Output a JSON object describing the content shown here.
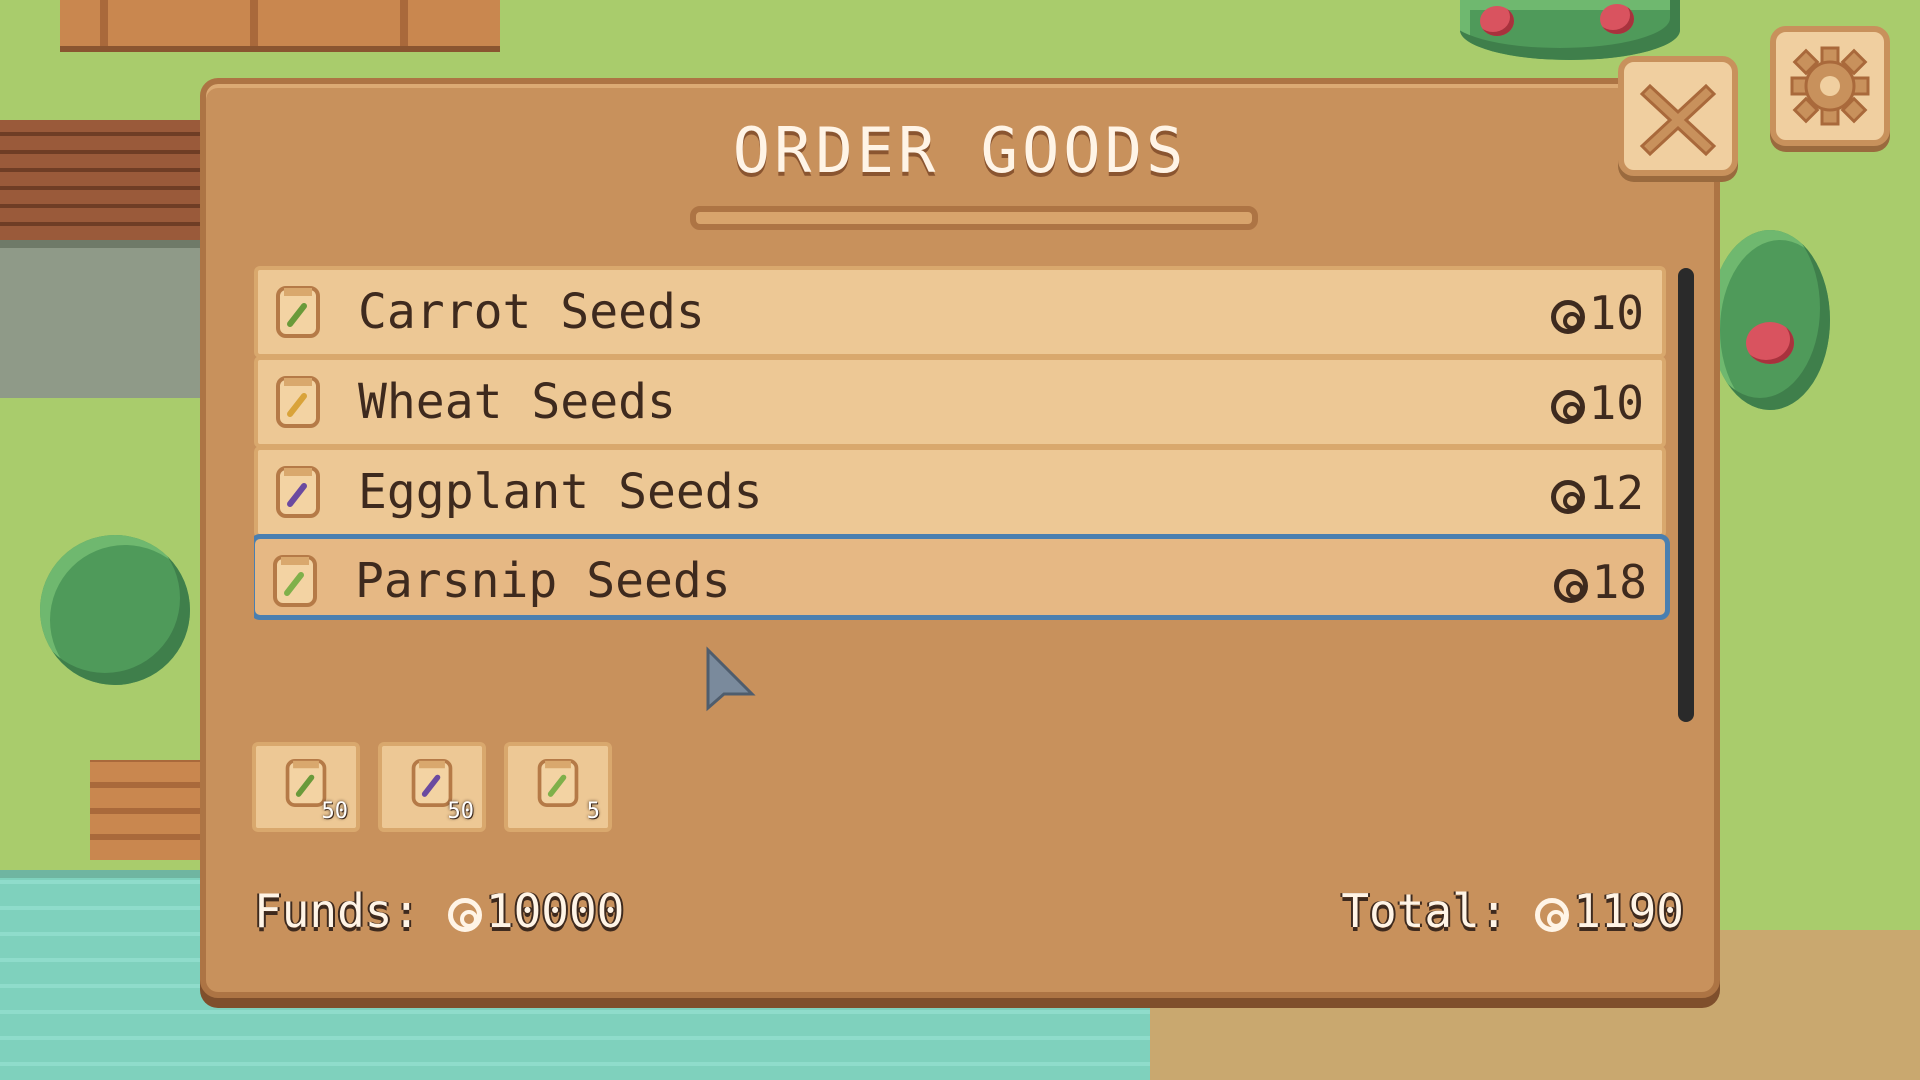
{
  "dialog": {
    "title": "ORDER GOODS",
    "items": [
      {
        "name": "Carrot Seeds",
        "price": "10",
        "icon": "carrot-seed-bag-icon",
        "accent": "#6a9a3a"
      },
      {
        "name": "Wheat Seeds",
        "price": "10",
        "icon": "wheat-seed-bag-icon",
        "accent": "#d9a33a"
      },
      {
        "name": "Eggplant Seeds",
        "price": "12",
        "icon": "eggplant-seed-bag-icon",
        "accent": "#6b4aa0"
      },
      {
        "name": "Parsnip Seeds",
        "price": "18",
        "icon": "parsnip-seed-bag-icon",
        "accent": "#7fb04a"
      }
    ],
    "selected_index": 3,
    "cart": [
      {
        "icon": "carrot-seed-bag-icon",
        "qty": "50",
        "accent": "#6a9a3a"
      },
      {
        "icon": "eggplant-seed-bag-icon",
        "qty": "50",
        "accent": "#6b4aa0"
      },
      {
        "icon": "parsnip-seed-bag-icon",
        "qty": "5",
        "accent": "#7fb04a"
      }
    ],
    "funds_label": "Funds:",
    "funds_value": "10000",
    "total_label": "Total:",
    "total_value": "1190"
  },
  "controls": {
    "close_icon": "close-icon",
    "settings_icon": "gear-icon"
  },
  "colors": {
    "panel": "#c8915c",
    "row": "#edc895",
    "selection": "#4a7fb0",
    "text": "#3e2a1e"
  }
}
